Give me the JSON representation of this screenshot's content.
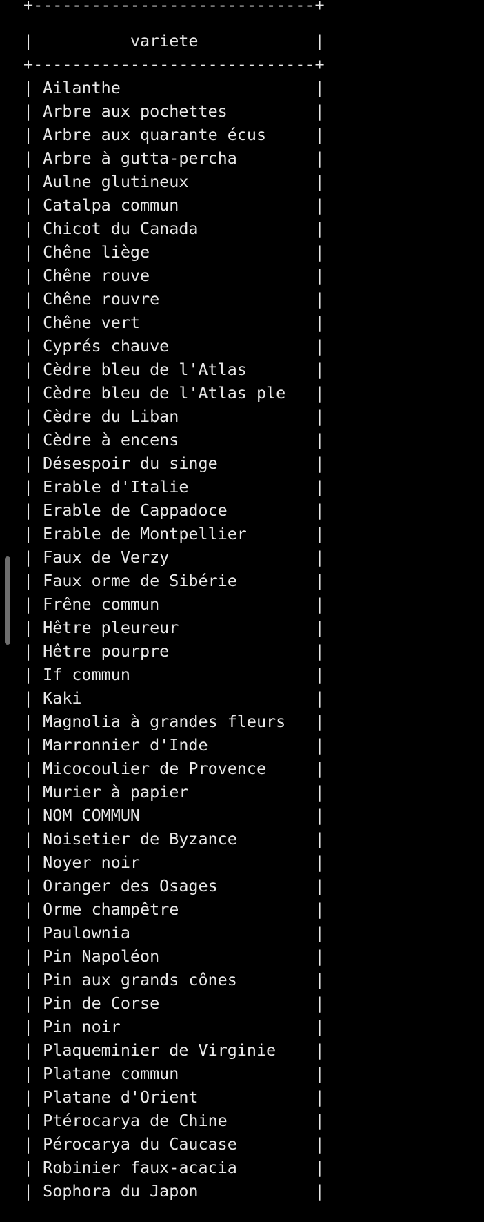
{
  "terminal": {
    "top_cutoff_line": "  ...",
    "border": "+-----------------------------+",
    "header_row": "|          variete            |",
    "rows": [
      "| Ailanthe                    |",
      "| Arbre aux pochettes         |",
      "| Arbre aux quarante écus     |",
      "| Arbre à gutta-percha        |",
      "| Aulne glutineux             |",
      "| Catalpa commun              |",
      "| Chicot du Canada            |",
      "| Chêne liège                 |",
      "| Chêne rouve                 |",
      "| Chêne rouvre                |",
      "| Chêne vert                  |",
      "| Cyprés chauve               |",
      "| Cèdre bleu de l'Atlas       |",
      "| Cèdre bleu de l'Atlas ple   |",
      "| Cèdre du Liban              |",
      "| Cèdre à encens              |",
      "| Désespoir du singe          |",
      "| Erable d'Italie             |",
      "| Erable de Cappadoce         |",
      "| Erable de Montpellier       |",
      "| Faux de Verzy               |",
      "| Faux orme de Sibérie        |",
      "| Frêne commun                |",
      "| Hêtre pleureur              |",
      "| Hêtre pourpre               |",
      "| If commun                   |",
      "| Kaki                        |",
      "| Magnolia à grandes fleurs   |",
      "| Marronnier d'Inde           |",
      "| Micocoulier de Provence     |",
      "| Murier à papier             |",
      "| NOM COMMUN                  |",
      "| Noisetier de Byzance        |",
      "| Noyer noir                  |",
      "| Oranger des Osages          |",
      "| Orme champêtre              |",
      "| Paulownia                   |",
      "| Pin Napoléon                |",
      "| Pin aux grands cônes        |",
      "| Pin de Corse                |",
      "| Pin noir                    |",
      "| Plaqueminier de Virginie    |",
      "| Platane commun              |",
      "| Platane d'Orient            |",
      "| Ptérocarya de Chine         |",
      "| Pérocarya du Caucase        |",
      "| Robinier faux-acacia        |",
      "| Sophora du Japon            |"
    ]
  },
  "colors": {
    "background": "#000000",
    "text": "#e8e8e8",
    "scrollbar": "#6e6e6e"
  }
}
